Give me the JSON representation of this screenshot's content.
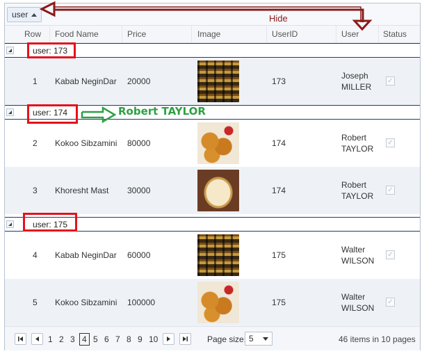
{
  "group_panel": {
    "chip_label": "user",
    "annotation": "Hide"
  },
  "columns": [
    "Row",
    "Food Name",
    "Price",
    "Image",
    "UserID",
    "User",
    "Status"
  ],
  "groups": [
    {
      "label": "user: 173",
      "rows": [
        {
          "row": "1",
          "food": "Kabab NeginDar",
          "price": "20000",
          "image": "kabab-image",
          "userid": "173",
          "user": "Joseph MILLER",
          "status": "checked"
        }
      ]
    },
    {
      "label": "user: 174",
      "annotation": "Robert TAYLOR",
      "rows": [
        {
          "row": "2",
          "food": "Kokoo Sibzamini",
          "price": "80000",
          "image": "kokoo-image",
          "userid": "174",
          "user": "Robert TAYLOR",
          "status": "checked"
        },
        {
          "row": "3",
          "food": "Khoresht Mast",
          "price": "30000",
          "image": "khoresht-image",
          "userid": "174",
          "user": "Robert TAYLOR",
          "status": "checked"
        }
      ]
    },
    {
      "label": "user: 175",
      "rows": [
        {
          "row": "4",
          "food": "Kabab NeginDar",
          "price": "60000",
          "image": "kabab-image",
          "userid": "175",
          "user": "Walter WILSON",
          "status": "checked"
        },
        {
          "row": "5",
          "food": "Kokoo Sibzamini",
          "price": "100000",
          "image": "kokoo-image",
          "userid": "175",
          "user": "Walter WILSON",
          "status": "checked"
        }
      ]
    }
  ],
  "pager": {
    "pages": [
      "1",
      "2",
      "3",
      "4",
      "5",
      "6",
      "7",
      "8",
      "9",
      "10"
    ],
    "current_page": "4",
    "page_size_label": "Page size:",
    "page_size": "5",
    "items_info": "46 items in 10 pages"
  },
  "colors": {
    "highlight_red": "#e3121c",
    "arrow_maroon": "#8b1a1a",
    "annotation_green": "#2ea043",
    "group_border": "#1f3b6e"
  }
}
